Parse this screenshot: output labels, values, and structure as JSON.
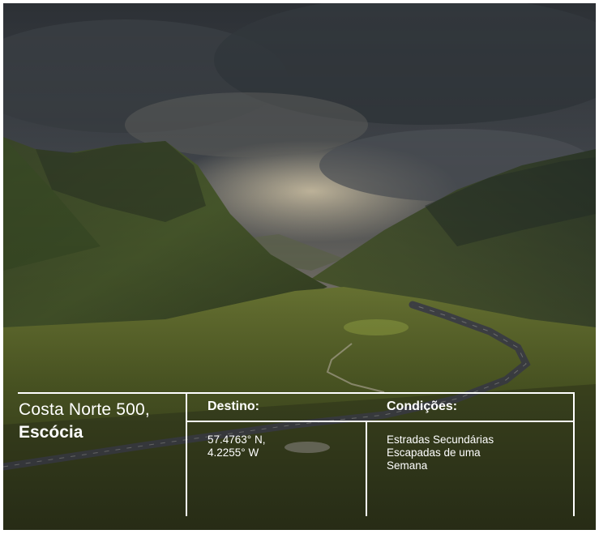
{
  "photo": {
    "subject": "mountain-valley-road",
    "colors": {
      "sky_dark": "#2f3338",
      "sky_light": "#c9b99a",
      "grass": "#5b6b2a",
      "road": "#4a4d52"
    }
  },
  "caption": {
    "title_line1": "Costa Norte 500,",
    "title_line2": "Escócia"
  },
  "destination": {
    "heading": "Destino:",
    "lat": "57.4763° N,",
    "lon": "4.2255° W"
  },
  "conditions": {
    "heading": "Condições:",
    "line1": "Estradas Secundárias",
    "line2": "Escapadas de uma",
    "line3": "Semana"
  }
}
